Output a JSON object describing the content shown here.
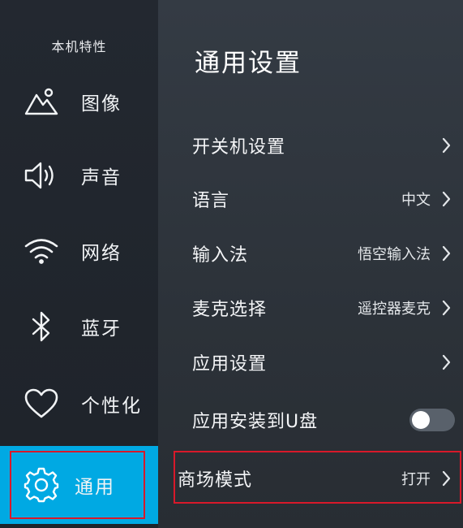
{
  "sidebar": {
    "heading": "本机特性",
    "items": [
      {
        "label": "图像",
        "icon": "image-icon"
      },
      {
        "label": "声音",
        "icon": "speaker-icon"
      },
      {
        "label": "网络",
        "icon": "wifi-icon"
      },
      {
        "label": "蓝牙",
        "icon": "bluetooth-icon"
      },
      {
        "label": "个性化",
        "icon": "heart-icon"
      },
      {
        "label": "通用",
        "icon": "gear-icon",
        "active": true
      }
    ]
  },
  "panel": {
    "title": "通用设置",
    "rows": [
      {
        "label": "开关机设置",
        "value": ""
      },
      {
        "label": "语言",
        "value": "中文"
      },
      {
        "label": "输入法",
        "value": "悟空输入法"
      },
      {
        "label": "麦克选择",
        "value": "遥控器麦克"
      },
      {
        "label": "应用设置",
        "value": ""
      },
      {
        "label": "应用安装到U盘",
        "toggle": false
      },
      {
        "label": "商场模式",
        "value": "打开"
      }
    ]
  },
  "colors": {
    "accent": "#00a9e3",
    "highlight": "#d8192a"
  }
}
